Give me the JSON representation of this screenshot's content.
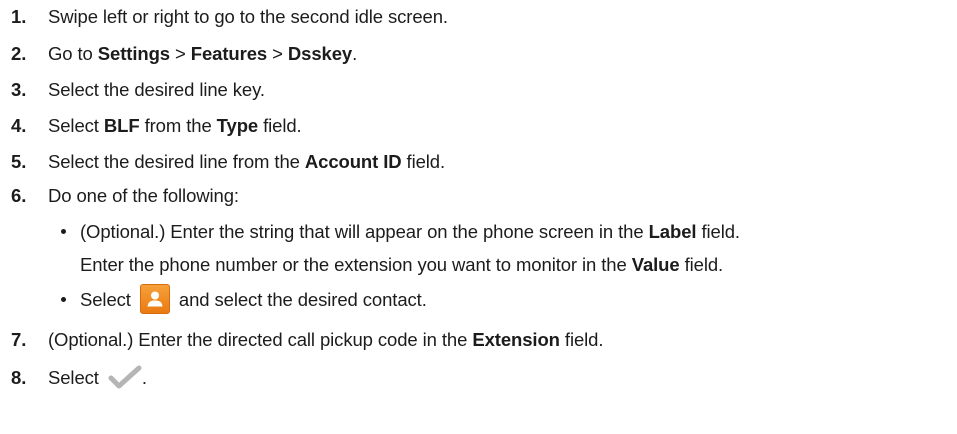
{
  "steps": [
    {
      "num": "1.",
      "parts": [
        "Swipe left or right to go to the second idle screen."
      ]
    },
    {
      "num": "2.",
      "parts": [
        "Go to ",
        "Settings",
        " > ",
        "Features",
        " > ",
        "Dsskey",
        "."
      ]
    },
    {
      "num": "3.",
      "parts": [
        "Select the desired line key."
      ]
    },
    {
      "num": "4.",
      "parts": [
        "Select ",
        "BLF",
        " from the ",
        "Type",
        " field."
      ]
    },
    {
      "num": "5.",
      "parts": [
        "Select the desired line from the ",
        "Account ID",
        " field."
      ]
    },
    {
      "num": "6.",
      "parts": [
        "Do one of the following:"
      ]
    },
    {
      "num": "7.",
      "parts": [
        "(Optional.) Enter the directed call pickup code in the ",
        "Extension",
        " field."
      ]
    },
    {
      "num": "8.",
      "parts": [
        "Select ",
        "."
      ]
    }
  ],
  "options": [
    {
      "line1": [
        "(Optional.) Enter the string that will appear on the phone screen in the ",
        "Label",
        " field."
      ],
      "line2": [
        "Enter the phone number or the extension you want to monitor in the ",
        "Value",
        " field."
      ]
    },
    {
      "parts": [
        "Select ",
        " and select the desired contact."
      ],
      "icon": "contact-icon"
    }
  ],
  "icons": {
    "step8": "checkmark-icon",
    "contact_color": "#f08a1e",
    "check_color": "#b5b5b5"
  }
}
